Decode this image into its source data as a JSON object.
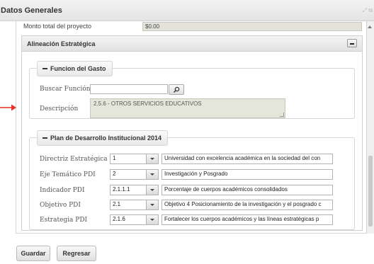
{
  "window": {
    "title": "Datos Generales",
    "icons_text": "⤢ ⧉"
  },
  "totals": {
    "label": "Monto total del proyecto",
    "value": "$0.00"
  },
  "alineacion": {
    "title": "Alineación Estratégica",
    "funcion_gasto": {
      "legend": "Funcion del Gasto",
      "buscar_label": "Buscar Función",
      "buscar_value": "",
      "descripcion_label": "Descripción",
      "descripcion_value": "2.5.6 - OTROS SERVICIOS EDUCATIVOS"
    },
    "plan": {
      "legend": "Plan de Desarrollo Institucional 2014",
      "rows": [
        {
          "label": "Directriz Estratégica",
          "code": "1",
          "description": "Universidad con excelencia académica en la sociedad del con"
        },
        {
          "label": "Eje Temático PDI",
          "code": "2",
          "description": "Investigación y Posgrado"
        },
        {
          "label": "Indicador PDI",
          "code": "2.1.1.1",
          "description": "Porcentaje de cuerpos académicos consolidados"
        },
        {
          "label": "Objetivo PDI",
          "code": "2.1",
          "description": "Objetivo 4 Posicionamiento de la investigación y el posgrado c"
        },
        {
          "label": "Estrategia PDI",
          "code": "2.1.6",
          "description": "Fortalecer los cuerpos académicos y las líneas estratégicas p"
        }
      ]
    }
  },
  "buttons": {
    "guardar": "Guardar",
    "regresar": "Regresar"
  },
  "colors": {
    "annotation_arrow": "#e8322b",
    "readonly_field": "#e5e6da"
  }
}
